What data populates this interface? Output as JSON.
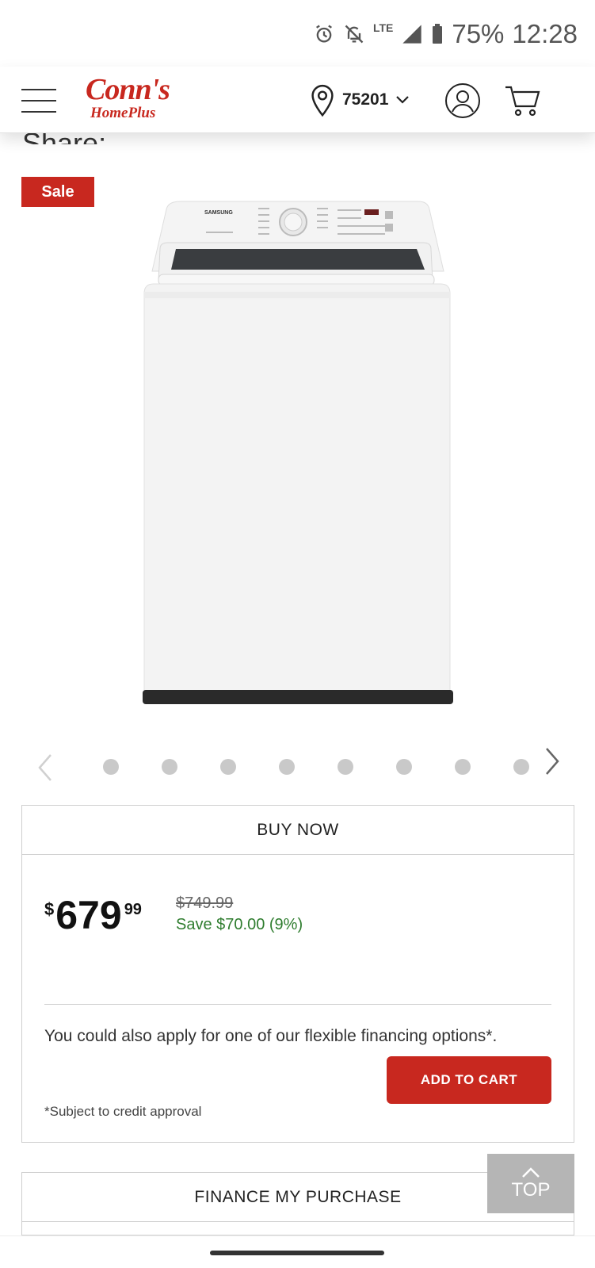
{
  "status_bar": {
    "lte": "LTE",
    "battery": "75%",
    "time": "12:28"
  },
  "header": {
    "logo_line1": "Conn's",
    "logo_line2": "HomePlus",
    "zip": "75201"
  },
  "share_label": "Share:",
  "badge": "Sale",
  "carousel": {
    "dot_count": 8
  },
  "buy_box": {
    "title": "BUY NOW",
    "currency": "$",
    "price_main": "679",
    "price_cents": "99",
    "was_price": "$749.99",
    "save_text": "Save $70.00 (9%)",
    "financing_message": "You could also apply for one of our flexible financing options*.",
    "add_to_cart": "ADD TO CART",
    "credit_note": "*Subject to credit approval"
  },
  "finance_box": {
    "title": "FINANCE MY PURCHASE"
  },
  "top_button": "TOP",
  "colors": {
    "brand_red": "#c8281f",
    "save_green": "#2f7d2f"
  },
  "product_image": {
    "brand_text": "SAMSUNG"
  }
}
